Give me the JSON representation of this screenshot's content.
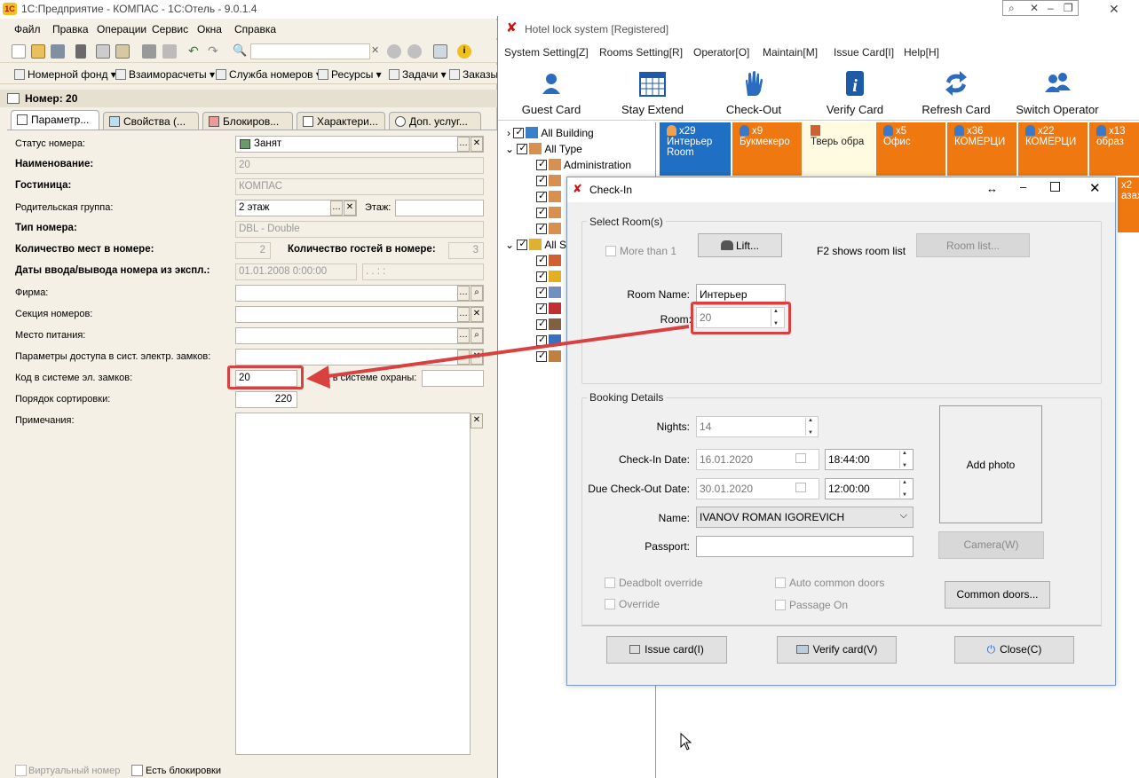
{
  "onec": {
    "title": "1С:Предприятие - КОМПАС - 1С:Отель - 9.0.1.4",
    "menu": [
      "Файл",
      "Правка",
      "Операции",
      "Сервис",
      "Окна",
      "Справка"
    ],
    "toolbar2": [
      "Номерной фонд",
      "Взаиморасчеты",
      "Служба номеров",
      "Ресурсы",
      "Задачи",
      "Заказы"
    ],
    "form_title": "Номер: 20",
    "tabs": [
      "Параметр...",
      "Свойства (...",
      "Блокиров...",
      "Характери...",
      "Доп. услуг..."
    ],
    "labels": {
      "status": "Статус номера:",
      "name": "Наименование:",
      "hotel": "Гостиница:",
      "parent": "Родительская группа:",
      "floor": "Этаж:",
      "type": "Тип номера:",
      "beds": "Количество мест в номере:",
      "guests": "Количество гостей в номере:",
      "dates": "Даты ввода/вывода номера из экспл.:",
      "firm": "Фирма:",
      "section": "Секция номеров:",
      "meal": "Место питания:",
      "access": "Параметры доступа в сист. электр. замков:",
      "lockcode": "Код в системе эл. замков:",
      "securitycode": "Код в системе охраны:",
      "sort": "Порядок сортировки:",
      "notes": "Примечания:",
      "virtual": "Виртуальный номер",
      "blocks": "Есть блокировки"
    },
    "values": {
      "status": "Занят",
      "name": "20",
      "hotel": "КОМПАС",
      "parent": "2 этаж",
      "type": "DBL - Double",
      "beds": "2",
      "guests": "3",
      "date_from": "01.01.2008  0:00:00",
      "date_to": " .  .      :  :",
      "lockcode": "20",
      "sort": "220"
    }
  },
  "hotel_lock": {
    "title": "Hotel lock system [Registered]",
    "menu": [
      "System Setting[Z]",
      "Rooms Setting[R]",
      "Operator[O]",
      "Maintain[M]",
      "Issue Card[I]",
      "Help[H]"
    ],
    "toolbar": [
      "Guest Card",
      "Stay Extend",
      "Check-Out",
      "Verify Card",
      "Refresh Card",
      "Switch Operator"
    ],
    "tree": {
      "all_building": "All Building",
      "all_type": "All Type",
      "administration": "Administration",
      "all_s": "All S"
    },
    "tiles": [
      {
        "count": "x29",
        "name": "Интерьер",
        "name2": "Room"
      },
      {
        "count": "x9",
        "name": "Букмекеро"
      },
      {
        "count": "",
        "name": "Тверь обра"
      },
      {
        "count": "x5",
        "name": "Офис"
      },
      {
        "count": "x36",
        "name": "КОМЕРЦИ"
      },
      {
        "count": "x22",
        "name": "КОМЕРЦИ"
      },
      {
        "count": "x13",
        "name": "образ"
      }
    ],
    "tile_right": {
      "count": "x2",
      "name": "азах"
    }
  },
  "checkin": {
    "title": "Check-In",
    "select_room": "Select Room(s)",
    "more_than_1": "More than 1",
    "lift": "Lift...",
    "f2_hint": "F2 shows room list",
    "room_list": "Room list...",
    "room_name_label": "Room Name:",
    "room_name": "Интерьер",
    "room_label": "Room:",
    "room_value": "20",
    "booking": "Booking Details",
    "nights_label": "Nights:",
    "nights": "14",
    "checkin_label": "Check-In Date:",
    "checkin_date": "16.01.2020",
    "checkin_time": "18:44:00",
    "checkout_label": "Due Check-Out Date:",
    "checkout_date": "30.01.2020",
    "checkout_time": "12:00:00",
    "name_label": "Name:",
    "name": "IVANOV ROMAN IGOREVICH",
    "passport_label": "Passport:",
    "add_photo": "Add photo",
    "camera": "Camera(W)",
    "deadbolt": "Deadbolt override",
    "override": "Override",
    "auto_common": "Auto common doors",
    "passage_on": "Passage On",
    "common_doors": "Common doors...",
    "issue_card": "Issue card(I)",
    "verify_card": "Verify card(V)",
    "close": "Close(C)"
  },
  "colors": {
    "accent_red": "#d94040",
    "tile_orange": "#f07810",
    "tile_blue": "#1f6fc4"
  }
}
